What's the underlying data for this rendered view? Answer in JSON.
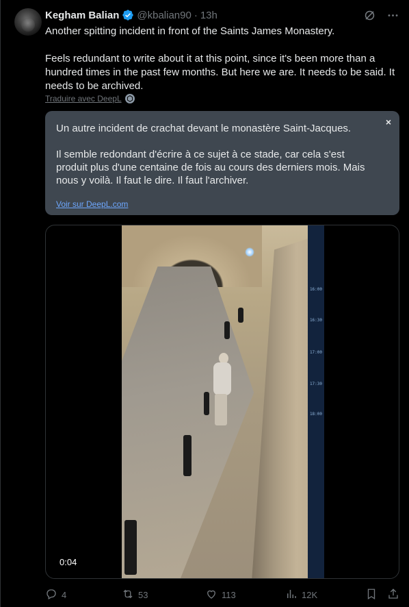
{
  "author": {
    "name": "Kegham Balian",
    "handle": "@kbalian90",
    "separator": "·",
    "time": "13h"
  },
  "tweet": {
    "paragraph1": "Another spitting incident in front of the Saints James Monastery.",
    "paragraph2": "Feels redundant to write about it at this point, since it's been more than a hundred times in the past few months. But here we are. It needs to be said. It needs to be archived."
  },
  "translate": {
    "link_label": "Traduire avec DeepL",
    "paragraph1": "Un autre incident de crachat devant le monastère Saint-Jacques.",
    "paragraph2": "Il semble redondant d'écrire à ce sujet à ce stade, car cela s'est produit plus d'une centaine de fois au cours des derniers mois. Mais nous y voilà. Il faut le dire. Il faut l'archiver.",
    "view_link": "Voir sur DeepL.com",
    "close": "×"
  },
  "video": {
    "time": "0:04",
    "timestamps": [
      "16:00",
      "16:30",
      "17:00",
      "17:30",
      "18:00"
    ]
  },
  "actions": {
    "replies": "4",
    "reposts": "53",
    "likes": "113",
    "views": "12K"
  },
  "colors": {
    "background": "#000000",
    "text": "#e7e9ea",
    "muted": "#71767b",
    "verified": "#1d9bf0",
    "translation_bg": "#3f4750",
    "link": "#6ea8ff"
  }
}
